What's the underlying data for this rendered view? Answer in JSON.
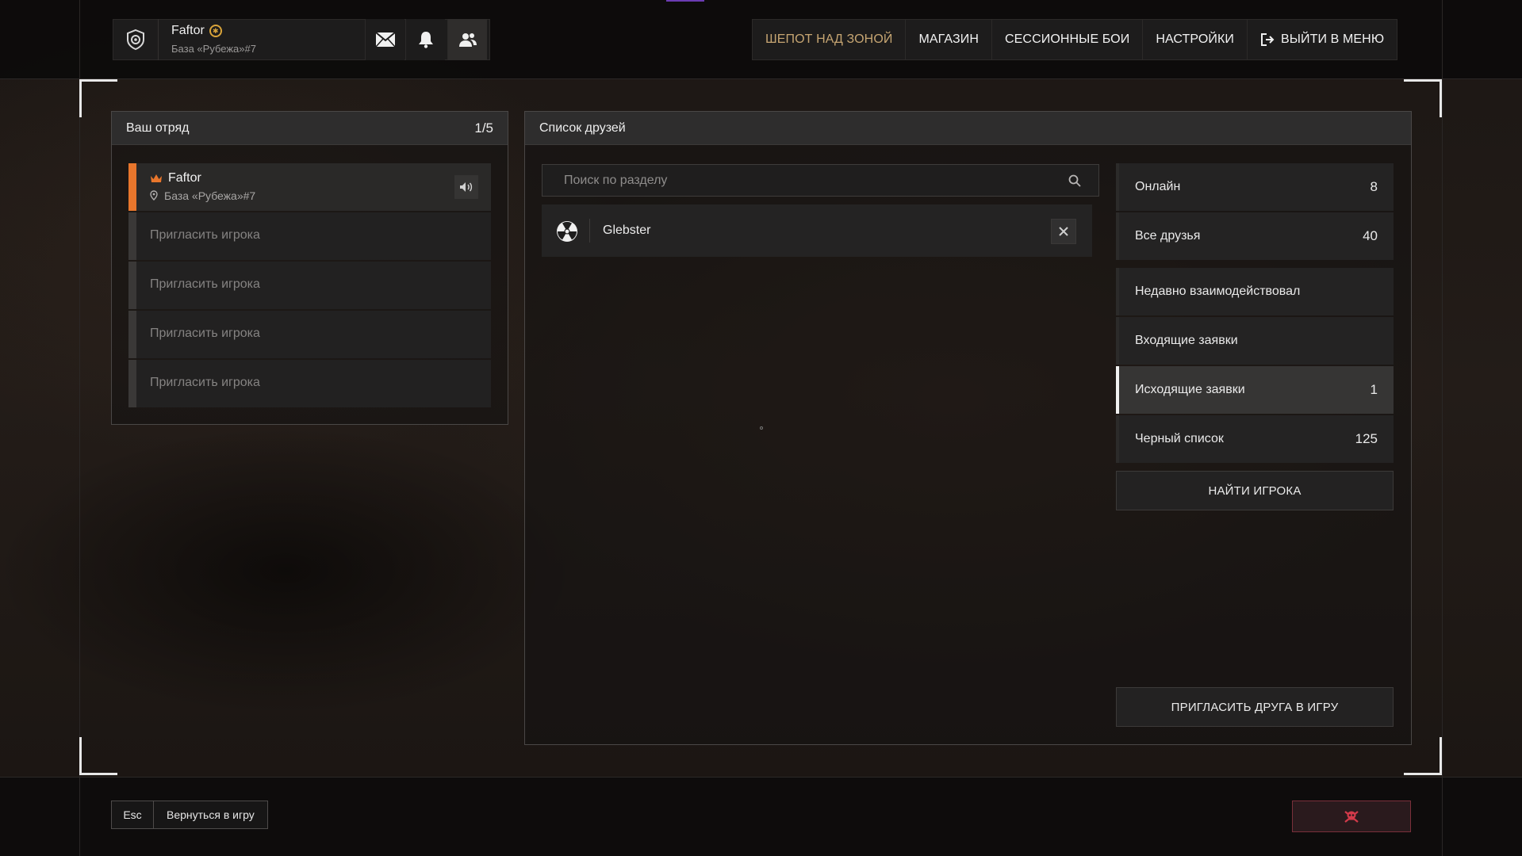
{
  "profile": {
    "name": "Faftor",
    "location": "База «Рубежа»#7",
    "rank_badge_symbol": "✱"
  },
  "top_icons": [
    "mail-icon",
    "bell-icon",
    "friends-icon"
  ],
  "nav": [
    "ШЕПОТ НАД ЗОНОЙ",
    "МАГАЗИН",
    "СЕССИОННЫЕ БОИ",
    "НАСТРОЙКИ",
    "ВЫЙТИ В МЕНЮ"
  ],
  "squad": {
    "title": "Ваш отряд",
    "count": "1/5",
    "leader": {
      "name": "Faftor",
      "location": "База «Рубежа»#7"
    },
    "invite_label": "Пригласить игрока"
  },
  "friends": {
    "title": "Список друзей",
    "search_placeholder": "Поиск по разделу",
    "list": [
      {
        "name": "Glebster"
      }
    ],
    "categories": [
      {
        "label": "Онлайн",
        "count": "8"
      },
      {
        "label": "Все друзья",
        "count": "40"
      },
      {
        "label": "Недавно взаимодействовал",
        "count": ""
      },
      {
        "label": "Входящие заявки",
        "count": ""
      },
      {
        "label": "Исходящие заявки",
        "count": "1"
      },
      {
        "label": "Черный список",
        "count": "125"
      }
    ],
    "find_player_label": "НАЙТИ ИГРОКА",
    "invite_friend_label": "ПРИГЛАСИТЬ ДРУГА В ИГРУ"
  },
  "footer": {
    "esc_key": "Esc",
    "back_label": "Вернуться в игру"
  },
  "colors": {
    "accent_orange": "#e8762c",
    "nav_gold": "#c6a572",
    "danger_red": "#d23a4a"
  }
}
